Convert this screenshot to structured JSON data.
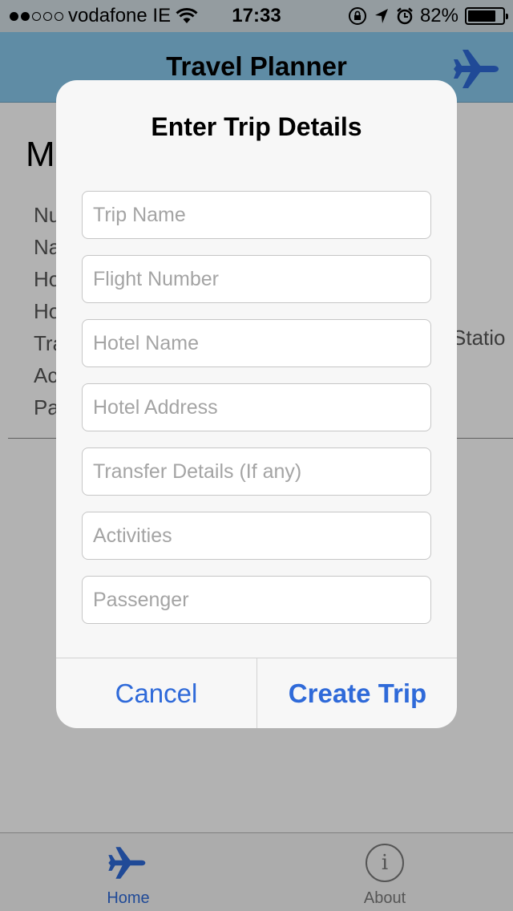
{
  "status_bar": {
    "carrier": "vodafone IE",
    "signal_bars_filled": 2,
    "signal_bars_total": 5,
    "time": "17:33",
    "battery_percent": "82%",
    "battery_level": 0.82
  },
  "nav": {
    "title": "Travel Planner",
    "icon": "airplane-icon"
  },
  "background": {
    "heading": "M",
    "rows": [
      "Nu",
      "Na",
      "Ho",
      "Ho",
      "Tra",
      "Ac",
      "Pa"
    ],
    "trailing_text": "Statio"
  },
  "dialog": {
    "title": "Enter Trip Details",
    "fields": [
      {
        "name": "trip-name-field",
        "placeholder": "Trip Name",
        "value": ""
      },
      {
        "name": "flight-number-field",
        "placeholder": "Flight Number",
        "value": ""
      },
      {
        "name": "hotel-name-field",
        "placeholder": "Hotel Name",
        "value": ""
      },
      {
        "name": "hotel-address-field",
        "placeholder": "Hotel Address",
        "value": ""
      },
      {
        "name": "transfer-details-field",
        "placeholder": "Transfer Details (If any)",
        "value": ""
      },
      {
        "name": "activities-field",
        "placeholder": "Activities",
        "value": ""
      },
      {
        "name": "passenger-field",
        "placeholder": "Passenger",
        "value": ""
      }
    ],
    "cancel_label": "Cancel",
    "create_label": "Create Trip"
  },
  "tab_bar": {
    "tabs": [
      {
        "label": "Home",
        "icon": "airplane-icon",
        "selected": true
      },
      {
        "label": "About",
        "icon": "info-icon",
        "selected": false
      }
    ]
  },
  "colors": {
    "nav_background": "#88c9ec",
    "accent": "#2f6ad9"
  }
}
